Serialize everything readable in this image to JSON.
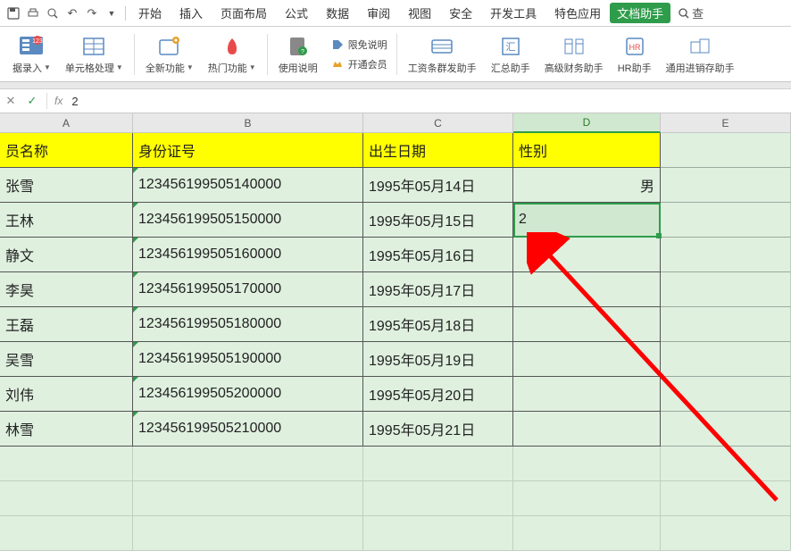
{
  "menu": {
    "items": [
      "开始",
      "插入",
      "页面布局",
      "公式",
      "数据",
      "审阅",
      "视图",
      "安全",
      "开发工具",
      "特色应用"
    ],
    "active": "文档助手",
    "search": "查"
  },
  "ribbon": {
    "g0": "据录入",
    "g1": "单元格处理",
    "g2": "全新功能",
    "g3": "热门功能",
    "g4": "使用说明",
    "s1": "限免说明",
    "s2": "开通会员",
    "g5": "工资条群发助手",
    "g6": "汇总助手",
    "g7": "高级财务助手",
    "g8": "HR助手",
    "g9": "通用进销存助手"
  },
  "formula": {
    "value": "2"
  },
  "columns": [
    "A",
    "B",
    "C",
    "D",
    "E"
  ],
  "headers": {
    "A": "员名称",
    "B": "身份证号",
    "C": "出生日期",
    "D": "性别"
  },
  "rows": [
    {
      "A": "张雪",
      "B": "123456199505140000",
      "C": "1995年05月14日",
      "D": "男"
    },
    {
      "A": "王林",
      "B": "123456199505150000",
      "C": "1995年05月15日",
      "D": "2"
    },
    {
      "A": "静文",
      "B": "123456199505160000",
      "C": "1995年05月16日",
      "D": ""
    },
    {
      "A": "李昊",
      "B": "123456199505170000",
      "C": "1995年05月17日",
      "D": ""
    },
    {
      "A": "王磊",
      "B": "123456199505180000",
      "C": "1995年05月18日",
      "D": ""
    },
    {
      "A": "吴雪",
      "B": "123456199505190000",
      "C": "1995年05月19日",
      "D": ""
    },
    {
      "A": "刘伟",
      "B": "123456199505200000",
      "C": "1995年05月20日",
      "D": ""
    },
    {
      "A": "林雪",
      "B": "123456199505210000",
      "C": "1995年05月21日",
      "D": ""
    }
  ],
  "active_cell": {
    "row": 2,
    "col": "D"
  }
}
